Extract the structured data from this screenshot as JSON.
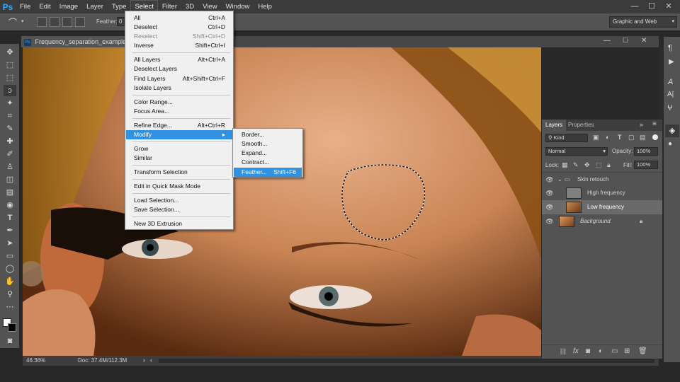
{
  "app": {
    "logo": "Ps"
  },
  "menubar": {
    "items": [
      "File",
      "Edit",
      "Image",
      "Layer",
      "Type",
      "Select",
      "Filter",
      "3D",
      "View",
      "Window",
      "Help"
    ],
    "active": "Select",
    "window_controls": [
      "—",
      "☐",
      "✕"
    ]
  },
  "options": {
    "feather_label": "Feather:",
    "feather_value": "0",
    "workspace": "Graphic and Web"
  },
  "document": {
    "tab_title": "Frequency_separation_example.jpg",
    "zoom": "46.36%",
    "doc_info": "Doc: 37.4M/112.3M"
  },
  "select_menu": {
    "items": [
      {
        "label": "All",
        "shortcut": "Ctrl+A",
        "disabled": false
      },
      {
        "label": "Deselect",
        "shortcut": "Ctrl+D",
        "disabled": false
      },
      {
        "label": "Reselect",
        "shortcut": "Shift+Ctrl+D",
        "disabled": true
      },
      {
        "label": "Inverse",
        "shortcut": "Shift+Ctrl+I",
        "disabled": false
      },
      {
        "label": "All Layers",
        "shortcut": "Alt+Ctrl+A",
        "disabled": false
      },
      {
        "label": "Deselect Layers",
        "shortcut": "",
        "disabled": false
      },
      {
        "label": "Find Layers",
        "shortcut": "Alt+Shift+Ctrl+F",
        "disabled": false
      },
      {
        "label": "Isolate Layers",
        "shortcut": "",
        "disabled": false
      },
      {
        "label": "Color Range...",
        "shortcut": "",
        "disabled": false
      },
      {
        "label": "Focus Area...",
        "shortcut": "",
        "disabled": false
      },
      {
        "label": "Refine Edge...",
        "shortcut": "Alt+Ctrl+R",
        "disabled": false
      },
      {
        "label": "Modify",
        "shortcut": "",
        "disabled": false
      },
      {
        "label": "Grow",
        "shortcut": "",
        "disabled": false
      },
      {
        "label": "Similar",
        "shortcut": "",
        "disabled": false
      },
      {
        "label": "Transform Selection",
        "shortcut": "",
        "disabled": false
      },
      {
        "label": "Edit in Quick Mask Mode",
        "shortcut": "",
        "disabled": false
      },
      {
        "label": "Load Selection...",
        "shortcut": "",
        "disabled": false
      },
      {
        "label": "Save Selection...",
        "shortcut": "",
        "disabled": false
      },
      {
        "label": "New 3D Extrusion",
        "shortcut": "",
        "disabled": false
      }
    ]
  },
  "modify_menu": {
    "items": [
      {
        "label": "Border...",
        "shortcut": ""
      },
      {
        "label": "Smooth...",
        "shortcut": ""
      },
      {
        "label": "Expand...",
        "shortcut": ""
      },
      {
        "label": "Contract...",
        "shortcut": ""
      },
      {
        "label": "Feather...",
        "shortcut": "Shift+F6"
      }
    ],
    "highlighted": "Feather..."
  },
  "layers_panel": {
    "tabs": [
      "Layers",
      "Properties"
    ],
    "filter_kind": "Kind",
    "blend_mode": "Normal",
    "opacity_label": "Opacity:",
    "opacity_value": "100%",
    "lock_label": "Lock:",
    "fill_label": "Fill:",
    "fill_value": "100%",
    "layers": [
      {
        "name": "Skin retouch",
        "type": "group"
      },
      {
        "name": "High frequency",
        "type": "layer"
      },
      {
        "name": "Low frequency",
        "type": "layer",
        "selected": true
      },
      {
        "name": "Background",
        "type": "background",
        "locked": true
      }
    ]
  },
  "colors": {
    "accent": "#3291e0",
    "panel": "#535353",
    "chrome": "#3b3b3b"
  }
}
